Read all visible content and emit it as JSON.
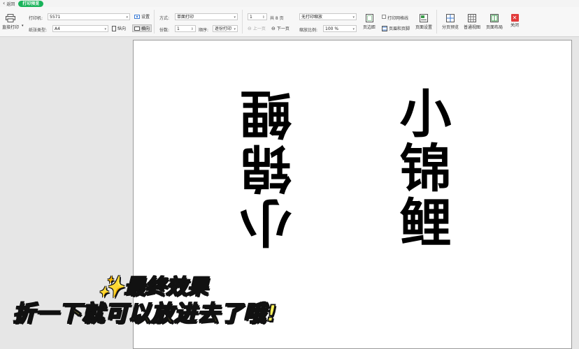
{
  "titlebar": {
    "back_label": "返回",
    "tab_label": "打印预览"
  },
  "toolbar": {
    "direct_print_label": "直接打印",
    "printer_label": "打印机:",
    "printer_value": "5571",
    "settings_label": "设置",
    "paper_type_label": "纸张类型:",
    "paper_type_value": "A4",
    "portrait_label": "纵向",
    "landscape_label": "横向",
    "mode_label": "方式:",
    "mode_value": "单面打印",
    "copies_label": "份数:",
    "copies_value": "1",
    "order_label": "顺序:",
    "order_value": "逐份打印",
    "page_value": "1",
    "page_total": "共 8 页",
    "prev_page_label": "上一页",
    "next_page_label": "下一页",
    "scale_mode_value": "无打印缩放",
    "scale_label": "缩放比例:",
    "scale_value": "100 %",
    "print_gridlines_label": "打印网格线",
    "header_footer_label": "页眉和页脚",
    "margins_label": "页边距",
    "page_setup_label": "页面设置",
    "page_break_preview_label": "分页预览",
    "normal_view_label": "普通视图",
    "page_layout_label": "页面布局",
    "close_label": "关闭"
  },
  "preview": {
    "text_rotated": "小锦鲤",
    "text_upright": "小锦鲤"
  },
  "overlay": {
    "line1": "✨最终效果",
    "line2": "折一下就可以放进去了哦!"
  },
  "colors": {
    "accent_green": "#19b35a",
    "close_red": "#e23b3b",
    "caption_yellow": "#fff25a"
  }
}
